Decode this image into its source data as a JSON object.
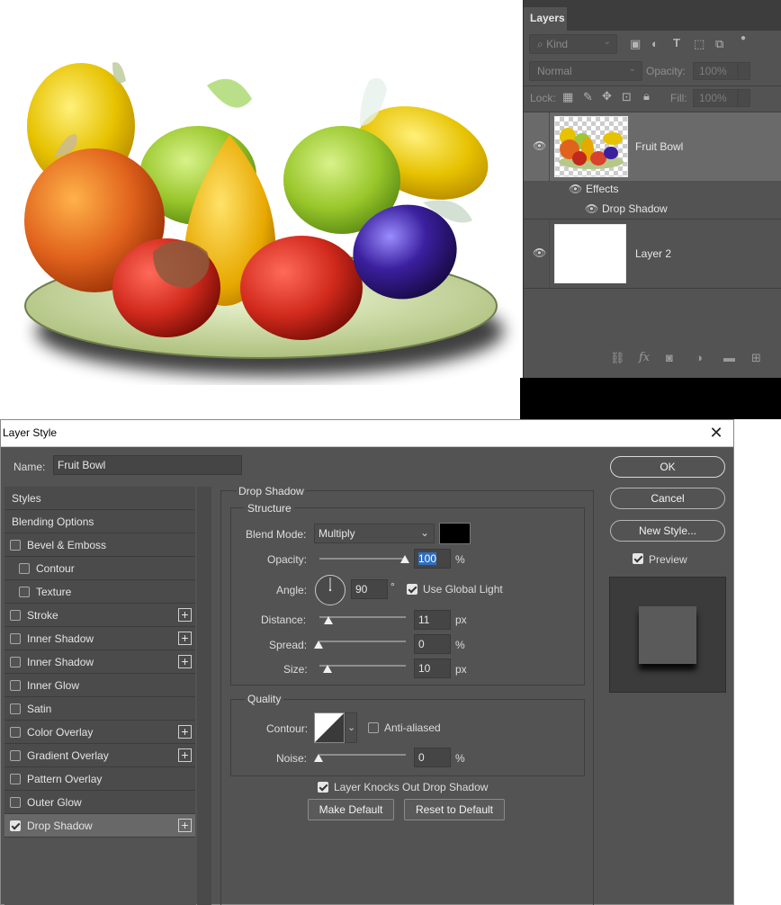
{
  "layers_panel": {
    "tab": "Layers",
    "filter_kind": "Kind",
    "blend_mode": "Normal",
    "opacity_label": "Opacity:",
    "opacity_value": "100%",
    "lock_label": "Lock:",
    "fill_label": "Fill:",
    "fill_value": "100%",
    "layers": [
      {
        "name": "Fruit Bowl",
        "effects_label": "Effects",
        "effect": "Drop Shadow"
      },
      {
        "name": "Layer 2"
      }
    ]
  },
  "dialog": {
    "title": "Layer Style",
    "name_label": "Name:",
    "name_value": "Fruit Bowl",
    "styles": [
      {
        "label": "Styles",
        "check": false,
        "has_check": false,
        "plus": false
      },
      {
        "label": "Blending Options",
        "check": false,
        "has_check": false,
        "plus": false
      },
      {
        "label": "Bevel & Emboss",
        "check": false,
        "has_check": true,
        "plus": false
      },
      {
        "label": "Contour",
        "check": false,
        "has_check": true,
        "plus": false,
        "indent": true
      },
      {
        "label": "Texture",
        "check": false,
        "has_check": true,
        "plus": false,
        "indent": true
      },
      {
        "label": "Stroke",
        "check": false,
        "has_check": true,
        "plus": true
      },
      {
        "label": "Inner Shadow",
        "check": false,
        "has_check": true,
        "plus": true
      },
      {
        "label": "Inner Shadow",
        "check": false,
        "has_check": true,
        "plus": true
      },
      {
        "label": "Inner Glow",
        "check": false,
        "has_check": true,
        "plus": false
      },
      {
        "label": "Satin",
        "check": false,
        "has_check": true,
        "plus": false
      },
      {
        "label": "Color Overlay",
        "check": false,
        "has_check": true,
        "plus": true
      },
      {
        "label": "Gradient Overlay",
        "check": false,
        "has_check": true,
        "plus": true
      },
      {
        "label": "Pattern Overlay",
        "check": false,
        "has_check": true,
        "plus": false
      },
      {
        "label": "Outer Glow",
        "check": false,
        "has_check": true,
        "plus": false
      },
      {
        "label": "Drop Shadow",
        "check": true,
        "has_check": true,
        "plus": true,
        "selected": true
      }
    ],
    "section_title": "Drop Shadow",
    "structure_title": "Structure",
    "blend_mode_label": "Blend Mode:",
    "blend_mode_value": "Multiply",
    "shadow_color": "#000000",
    "opacity_label": "Opacity:",
    "opacity_value": "100",
    "opacity_unit": "%",
    "angle_label": "Angle:",
    "angle_value": "90",
    "angle_unit": "°",
    "global_light_label": "Use Global Light",
    "distance_label": "Distance:",
    "distance_value": "11",
    "distance_unit": "px",
    "spread_label": "Spread:",
    "spread_value": "0",
    "spread_unit": "%",
    "size_label": "Size:",
    "size_value": "10",
    "size_unit": "px",
    "quality_title": "Quality",
    "contour_label": "Contour:",
    "anti_aliased_label": "Anti-aliased",
    "noise_label": "Noise:",
    "noise_value": "0",
    "noise_unit": "%",
    "knockout_label": "Layer Knocks Out Drop Shadow",
    "make_default_label": "Make Default",
    "reset_default_label": "Reset to Default",
    "ok_label": "OK",
    "cancel_label": "Cancel",
    "new_style_label": "New Style...",
    "preview_label": "Preview"
  }
}
